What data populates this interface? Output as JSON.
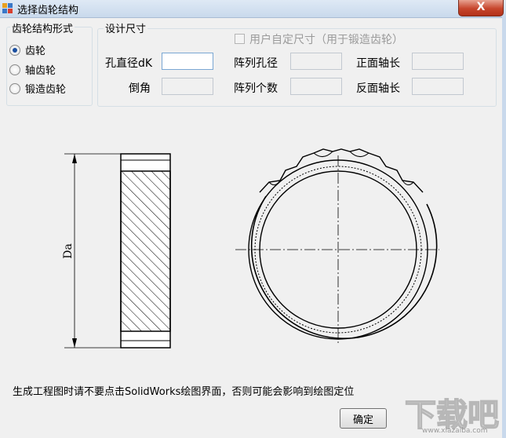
{
  "window": {
    "title": "选择齿轮结构",
    "close_label": "X"
  },
  "structure_group": {
    "title": "齿轮结构形式",
    "options": [
      {
        "label": "齿轮",
        "checked": true
      },
      {
        "label": "轴齿轮",
        "checked": false
      },
      {
        "label": "锻造齿轮",
        "checked": false
      }
    ]
  },
  "design_group": {
    "title": "设计尺寸",
    "custom_checkbox_label": "用户自定尺寸（用于锻造齿轮）",
    "fields": {
      "bore_dia": {
        "label": "孔直径dK",
        "value": ""
      },
      "chamfer": {
        "label": "倒角",
        "value": ""
      },
      "array_hole_dia": {
        "label": "阵列孔径",
        "value": ""
      },
      "array_count": {
        "label": "阵列个数",
        "value": ""
      },
      "front_hub_length": {
        "label": "正面轴长",
        "value": ""
      },
      "back_hub_length": {
        "label": "反面轴长",
        "value": ""
      }
    }
  },
  "drawing": {
    "dimension_label": "Da"
  },
  "note": "生成工程图时请不要点击SolidWorks绘图界面，否则可能会影响到绘图定位",
  "ok_button_label": "确定",
  "watermark": {
    "logo_text": "下载吧",
    "sub_text": "www.xiazaiba.com"
  }
}
